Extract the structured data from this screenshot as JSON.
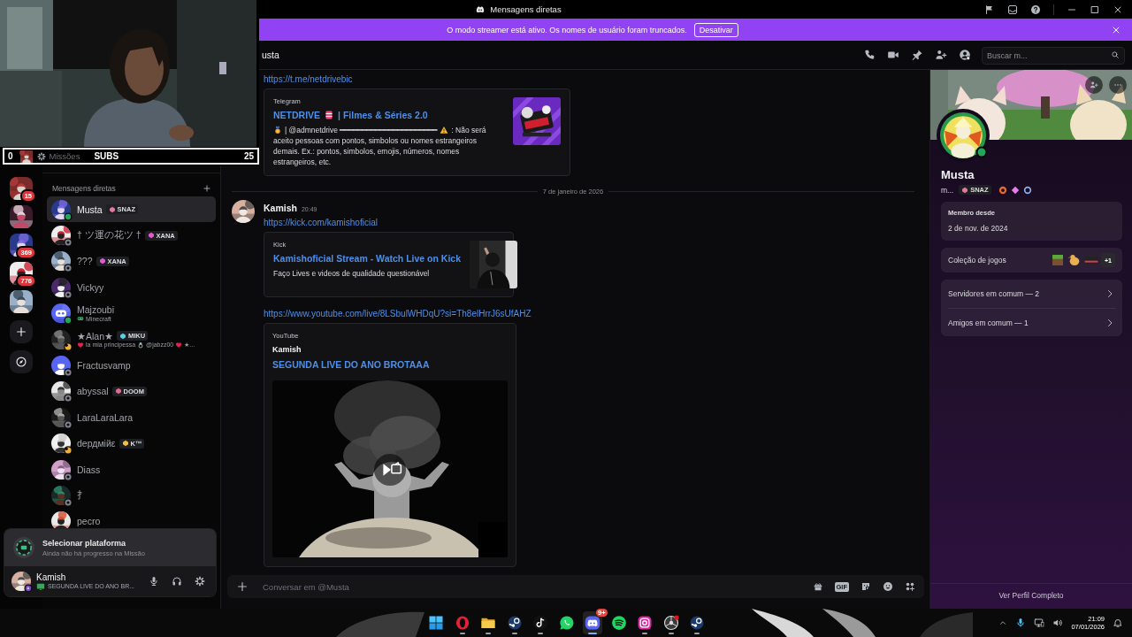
{
  "window": {
    "title": "Mensagens diretas"
  },
  "streamer_banner": {
    "text": "O modo streamer está ativo. Os nomes de usuário foram truncados.",
    "button": "Desativar"
  },
  "webcam_overlay": {
    "kind": "picture",
    "left_count": "0",
    "missions": "Missões",
    "label": "SUBS",
    "count": "25"
  },
  "servers": [
    {
      "kind": "picture",
      "badge": "15"
    },
    {
      "kind": "picture"
    },
    {
      "kind": "picture",
      "badge": "369"
    },
    {
      "kind": "picture",
      "badge": "776"
    },
    {
      "kind": "picture"
    }
  ],
  "dm_list": {
    "title": "Mensagens diretas",
    "items": [
      {
        "name": "Musta",
        "tag": {
          "text": "SNAZ",
          "color": "#e2789f"
        },
        "presence": {
          "kind": "online",
          "color": "#23a55a"
        },
        "selected": true
      },
      {
        "name": "† ツ運の花ツ †",
        "tag": {
          "text": "XANA",
          "color": "#e05ad0"
        },
        "presence": {
          "kind": "offline",
          "color": "#80848e"
        },
        "selected": false
      },
      {
        "name": "???",
        "tag": {
          "text": "XANA",
          "color": "#e05ad0"
        },
        "presence": {
          "kind": "offline",
          "color": "#80848e"
        },
        "selected": false
      },
      {
        "name": "Vickyy",
        "presence": {
          "kind": "offline",
          "color": "#80848e"
        },
        "selected": false
      },
      {
        "name": "Majzoubi",
        "presence": {
          "kind": "online",
          "color": "#23a55a"
        },
        "selected": false,
        "activity": {
          "kind": "game",
          "parts": [
            "Minecraft"
          ]
        }
      },
      {
        "name": "★Alan★",
        "tag": {
          "text": "MIKU",
          "color": "#5ad0e6"
        },
        "presence": {
          "kind": "idle",
          "color": "#f0b232"
        },
        "selected": false,
        "activity": {
          "kind": "custom",
          "parts": [
            "la mia principessa",
            "@jabzz00",
            "★..."
          ]
        }
      },
      {
        "name": "Fractusvamp",
        "presence": {
          "kind": "offline",
          "color": "#80848e"
        },
        "selected": false
      },
      {
        "name": "abyssal",
        "tag": {
          "text": "DOOM",
          "color": "#e06a8a"
        },
        "presence": {
          "kind": "offline",
          "color": "#80848e"
        },
        "selected": false
      },
      {
        "name": "LaraLaraLara",
        "presence": {
          "kind": "offline",
          "color": "#80848e"
        },
        "selected": false
      },
      {
        "name": "dердмійε",
        "tag": {
          "text": "K™",
          "color": "#f0c040"
        },
        "presence": {
          "kind": "idle",
          "color": "#f0b232"
        },
        "selected": false
      },
      {
        "name": "Diass",
        "presence": {
          "kind": "offline",
          "color": "#80848e"
        },
        "selected": false
      },
      {
        "name": "⺘",
        "presence": {
          "kind": "offline",
          "color": "#80848e"
        },
        "selected": false
      },
      {
        "name": "pecro",
        "selected": false
      }
    ]
  },
  "header": {
    "title": "usta",
    "search_placeholder": "Buscar m..."
  },
  "messages": [
    {
      "kind": "continuation",
      "link": "https://t.me/netdrivebic",
      "embed": {
        "kind": "telegram-card",
        "provider": "Telegram",
        "title_parts": [
          "NETDRIVE",
          "| Filmes & Séries 2.0"
        ],
        "description_parts": [
          "| @admnetdrive ━━━━━━━━━━━━━━━━━━━━━━",
          ": Não será",
          "aceito pessoas com pontos, simbolos ou nomes estrangeiros demais. Ex.: pontos, simbolos, emojis, números, nomes estrangeiros, etc."
        ]
      }
    },
    {
      "kind": "divider",
      "text": "7 de janeiro de 2026"
    },
    {
      "kind": "message",
      "author": "Kamish",
      "time": "20:49",
      "link": "https://kick.com/kamishoficial",
      "embed": {
        "kind": "card",
        "provider": "Kick",
        "title": "Kamishoficial Stream - Watch Live on Kick",
        "description": "Faço Lives e videos de qualidade questionável"
      }
    },
    {
      "kind": "continuation",
      "link": "https://www.youtube.com/live/8LSbulWHDqU?si=Th8elHrrJ6sUfAHZ",
      "embed": {
        "kind": "video",
        "provider": "YouTube",
        "author": "Kamish",
        "title": "SEGUNDA LIVE DO ANO BROTAAA"
      }
    }
  ],
  "composer": {
    "placeholder": "Conversar em @Musta",
    "gif_label": "GIF"
  },
  "user_panel": {
    "quest": {
      "title": "Selecionar plataforma",
      "subtitle": "Ainda não há progresso na Missão"
    },
    "user": {
      "name": "Kamish",
      "activity": "SEGUNDA LIVE DO ANO BR...",
      "presence": {
        "kind": "streaming",
        "color": "#7a4cc9"
      }
    }
  },
  "profile": {
    "name": "Musta",
    "handle": "m...",
    "tag": {
      "text": "SNAZ",
      "color": "#e2789f"
    },
    "presence": {
      "kind": "online",
      "color": "#23a55a"
    },
    "member_since_label": "Membro desde",
    "member_since": "2 de nov. de 2024",
    "games_label": "Coleção de jogos",
    "games_more": "+1",
    "links": [
      "Servidores em comum — 2",
      "Amigos em comum — 1"
    ],
    "full_profile": "Ver Perfil Completo"
  },
  "taskbar": {
    "apps": [
      {
        "kind": "start",
        "running": false,
        "selected": false
      },
      {
        "kind": "browser",
        "running": true,
        "selected": false
      },
      {
        "kind": "folder",
        "running": true,
        "selected": false
      },
      {
        "kind": "steam",
        "running": true,
        "selected": false
      },
      {
        "kind": "note",
        "running": true,
        "selected": false
      },
      {
        "kind": "chat",
        "running": false,
        "selected": false
      },
      {
        "kind": "controller",
        "running": true,
        "selected": true,
        "badge": "9+"
      },
      {
        "kind": "music",
        "running": false,
        "selected": false
      },
      {
        "kind": "camera",
        "running": true,
        "selected": false
      },
      {
        "kind": "disc",
        "running": true,
        "selected": false
      },
      {
        "kind": "steam",
        "running": true,
        "selected": false
      }
    ],
    "time": "21:09",
    "date": "07/01/2026"
  }
}
